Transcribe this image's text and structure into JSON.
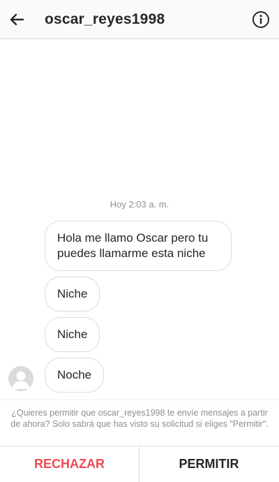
{
  "header": {
    "username": "oscar_reyes1998",
    "back_icon": "arrow-left-icon",
    "info_icon": "info-icon"
  },
  "conversation": {
    "timestamp": "Hoy 2:03 a. m.",
    "messages": [
      {
        "text": "Hola me llamo Oscar pero tu puedes llamarme esta niche"
      },
      {
        "text": "Niche"
      },
      {
        "text": "Niche"
      },
      {
        "text": "Noche"
      }
    ]
  },
  "request": {
    "notice": "¿Quieres permitir que oscar_reyes1998 te envíe mensajes a partir de ahora? Solo sabrá que has visto su solicitud si eliges \"Permitir\".",
    "reject_label": "RECHAZAR",
    "allow_label": "PERMITIR"
  },
  "colors": {
    "reject": "#ed4956",
    "text": "#262626",
    "muted": "#8e8e8e",
    "border": "#dbdbdb"
  }
}
